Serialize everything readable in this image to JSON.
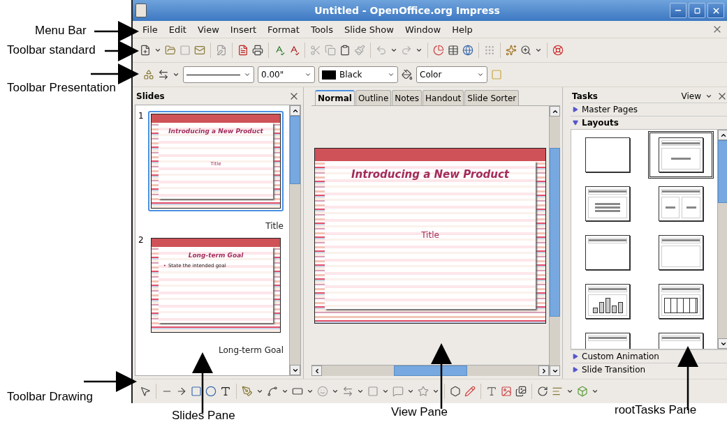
{
  "annotations": [
    {
      "label": "Menu Bar"
    },
    {
      "label": "Toolbar standard"
    },
    {
      "label": "Toolbar Presentation"
    },
    {
      "label": "Toolbar Drawing"
    },
    {
      "label": "Slides Pane"
    },
    {
      "label": "View Pane"
    },
    {
      "label": "rootTasks Pane"
    }
  ],
  "window": {
    "title": "Untitled - OpenOffice.org Impress"
  },
  "menu": [
    "File",
    "Edit",
    "View",
    "Insert",
    "Format",
    "Tools",
    "Slide Show",
    "Window",
    "Help"
  ],
  "line_toolbar": {
    "line_width": "0.00\"",
    "line_color": "Black",
    "area_style": "Color"
  },
  "slides_pane": {
    "title": "Slides",
    "slides": [
      {
        "number": "1",
        "kind": "title",
        "title": "Introducing a New Product",
        "body": "Title",
        "caption": "Title",
        "selected": true
      },
      {
        "number": "2",
        "kind": "bullets",
        "title": "Long-term Goal",
        "marker": "•",
        "body": "State the intended goal",
        "caption": "Long-term Goal",
        "selected": false
      }
    ]
  },
  "view_tabs": [
    {
      "label": "Normal",
      "selected": true
    },
    {
      "label": "Outline",
      "selected": false
    },
    {
      "label": "Notes",
      "selected": false
    },
    {
      "label": "Handout",
      "selected": false
    },
    {
      "label": "Slide Sorter",
      "selected": false
    }
  ],
  "main_slide": {
    "title": "Introducing a New Product",
    "subtitle": "Title"
  },
  "tasks_pane": {
    "title": "Tasks",
    "view": "View",
    "sections": [
      {
        "label": "Master Pages",
        "expanded": false
      },
      {
        "label": "Layouts",
        "expanded": true
      },
      {
        "label": "Custom Animation",
        "expanded": false
      },
      {
        "label": "Slide Transition",
        "expanded": false
      }
    ],
    "layouts": [
      {
        "kind": "blank",
        "selected": false
      },
      {
        "kind": "title-content",
        "selected": true
      },
      {
        "kind": "title-bullets",
        "selected": false
      },
      {
        "kind": "title-two-columns",
        "selected": false
      },
      {
        "kind": "title-only",
        "selected": false
      },
      {
        "kind": "title-box",
        "selected": false
      },
      {
        "kind": "title-chart",
        "selected": false
      },
      {
        "kind": "title-table",
        "selected": false
      },
      {
        "kind": "title-only",
        "selected": false
      },
      {
        "kind": "title-only",
        "selected": false
      }
    ]
  }
}
